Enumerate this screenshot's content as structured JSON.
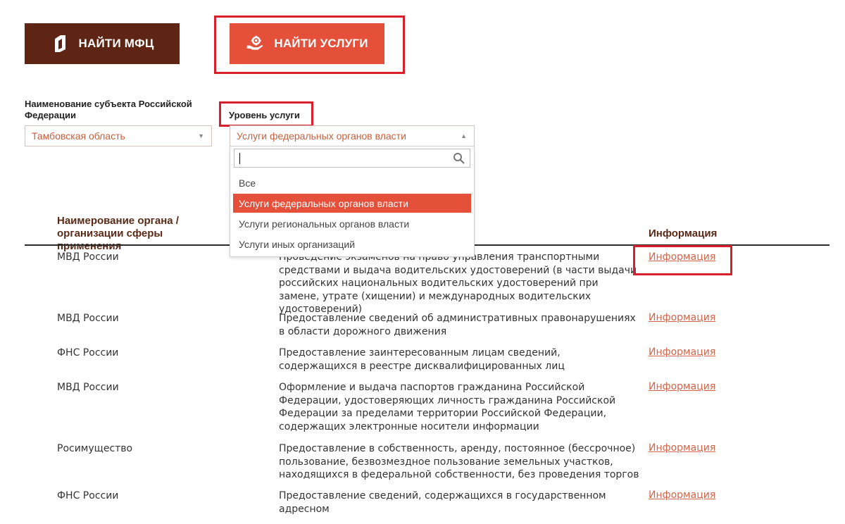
{
  "buttons": {
    "find_mfc": "НАЙТИ МФЦ",
    "find_services": "НАЙТИ УСЛУГИ"
  },
  "filters": {
    "region_label": "Наименование субъекта Российской Федерации",
    "region_value": "Тамбовская область",
    "level_label": "Уровень услуги",
    "level_value": "Услуги федеральных органов власти"
  },
  "dropdown": {
    "search_value": "",
    "options": [
      "Все",
      "Услуги федеральных органов власти",
      "Услуги региональных органов власти",
      "Услуги иных организаций"
    ],
    "selected_index": 1
  },
  "table": {
    "col_org": "Наимерование органа / организации сферы применения",
    "col_info": "Информация",
    "rows": [
      {
        "org": "МВД России",
        "service": "Проведение экзаменов на право управления транспортными средствами и выдача водительских удостоверений (в части выдачи российских национальных водительских удостоверений при замене, утрате (хищении) и международных водительских удостоверений)",
        "info": "Информация"
      },
      {
        "org": "МВД России",
        "service": "Предоставление сведений об административных правонарушениях в области дорожного движения",
        "info": "Информация"
      },
      {
        "org": "ФНС России",
        "service": "Предоставление заинтересованным лицам сведений, содержащихся в реестре дисквалифицированных лиц",
        "info": "Информация"
      },
      {
        "org": "МВД России",
        "service": "Оформление и выдача паспортов гражданина Российской Федерации, удостоверяющих личность гражданина Российской Федерации за пределами территории Российской Федерации, содержащих электронные носители информации",
        "info": "Информация"
      },
      {
        "org": "Росимущество",
        "service": "Предоставление в собственность, аренду, постоянное (бессрочное) пользование, безвозмездное пользование земельных участков, находящихся в федеральной собственности, без проведения торгов",
        "info": "Информация"
      },
      {
        "org": "ФНС России",
        "service": "Предоставление сведений, содержащихся в государственном адресном",
        "info": "Информация"
      }
    ]
  },
  "colors": {
    "mfc_button": "#5e2414",
    "services_button": "#e5503a",
    "highlight": "#d8202c",
    "link": "#d2654b"
  }
}
